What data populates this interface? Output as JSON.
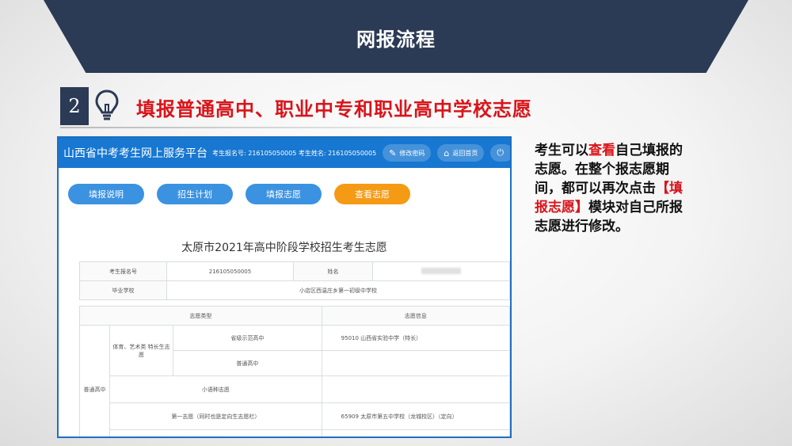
{
  "banner": {
    "title": "网报流程"
  },
  "step": {
    "number": "2",
    "title": "填报普通高中、职业中专和职业高中学校志愿"
  },
  "screenshot": {
    "site_name": "山西省中考考生网上服务平台",
    "meta": "考生报名号: 216105050005 考生姓名: 216105050005",
    "header_buttons": [
      "修改密码",
      "返回首页"
    ],
    "tabs": [
      "填报说明",
      "招生计划",
      "填报志愿",
      "查看志愿"
    ],
    "active_tab": "查看志愿",
    "form_title": "太原市2021年高中阶段学校招生考生志愿",
    "info": {
      "reg_label": "考生报名号",
      "reg_value": "216105050005",
      "name_label": "姓名",
      "school_label": "毕业学校",
      "school_value": "小店区西温庄乡第一初级中学校"
    },
    "table": {
      "col_type": "志愿类型",
      "col_info": "志愿信息",
      "special_group": "体育、艺术类 特长生志愿",
      "demo_school": "省级示范高中",
      "demo_school_value": "95010 山西省实验中学（特长）",
      "normal_school": "普通高中",
      "small_lang": "小语种志愿",
      "first_choice": "第一志愿（同时也是定向生志愿栏）",
      "first_choice_value": "65909 太原市第五中学校（龙城校区）（定向）",
      "vertical_group": "普通高中"
    }
  },
  "description": {
    "line_a": "考生可以",
    "highlight_1": "查看",
    "line_b": "自己填报的志愿。在整个报志愿期间，都可以再次点击",
    "highlight_2": "【填报志愿】",
    "line_c": "模块对自己所报志愿进行修改。"
  },
  "colors": {
    "accent": "#d9141a",
    "banner": "#2b3a55",
    "primary": "#1777d1",
    "active_tab": "#f59a14"
  }
}
